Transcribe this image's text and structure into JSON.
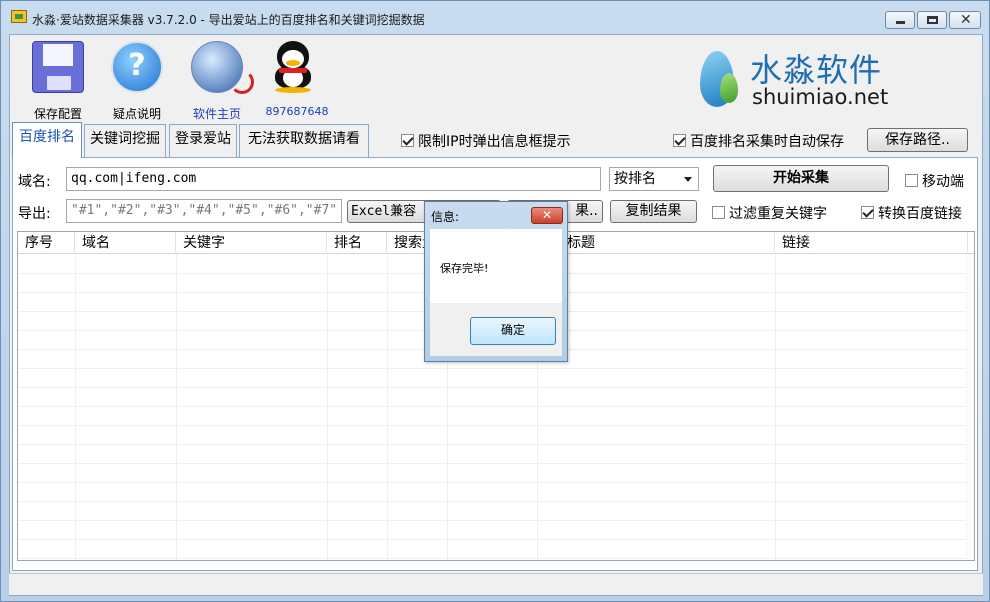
{
  "window": {
    "title": "水淼·爱站数据采集器 v3.7.2.0 - 导出爱站上的百度排名和关键词挖掘数据",
    "min_glyph": "",
    "max_glyph": "",
    "close_glyph": "✕"
  },
  "toolbar": {
    "save_label": "保存配置",
    "help_label": "疑点说明",
    "help_glyph": "?",
    "home_label": "软件主页",
    "qq_label": "897687648"
  },
  "logo": {
    "cn": "水淼软件",
    "en": "shuimiao.net"
  },
  "tabs": [
    {
      "label": "百度排名",
      "active": true
    },
    {
      "label": "关键词挖掘",
      "active": false
    },
    {
      "label": "登录爱站",
      "active": false
    },
    {
      "label": "无法获取数据请看",
      "active": false
    }
  ],
  "options": {
    "ip_limit_prompt": "限制IP时弹出信息框提示",
    "auto_save": "百度排名采集时自动保存",
    "save_path_button": "保存路径..",
    "mobile": "移动端",
    "filter_duplicates": "过滤重复关键字",
    "convert_baidu_links": "转换百度链接"
  },
  "form": {
    "domain_label": "域名:",
    "domain_value": "qq.com|ifeng.com",
    "sort_select": "按排名",
    "start_button": "开始采集",
    "export_label": "导出:",
    "export_value": "\"#1\",\"#2\",\"#3\",\"#4\",\"#5\",\"#6\",\"#7\"",
    "excel_button": "Excel兼容",
    "save_result_button": "果..",
    "copy_result_button": "复制结果"
  },
  "table": {
    "columns": [
      "序号",
      "域名",
      "关键字",
      "排名",
      "搜索量",
      "",
      "标题",
      "链接"
    ]
  },
  "dialog": {
    "title": "信息:",
    "close_glyph": "✕",
    "message": "保存完毕!",
    "ok_button": "确定"
  }
}
